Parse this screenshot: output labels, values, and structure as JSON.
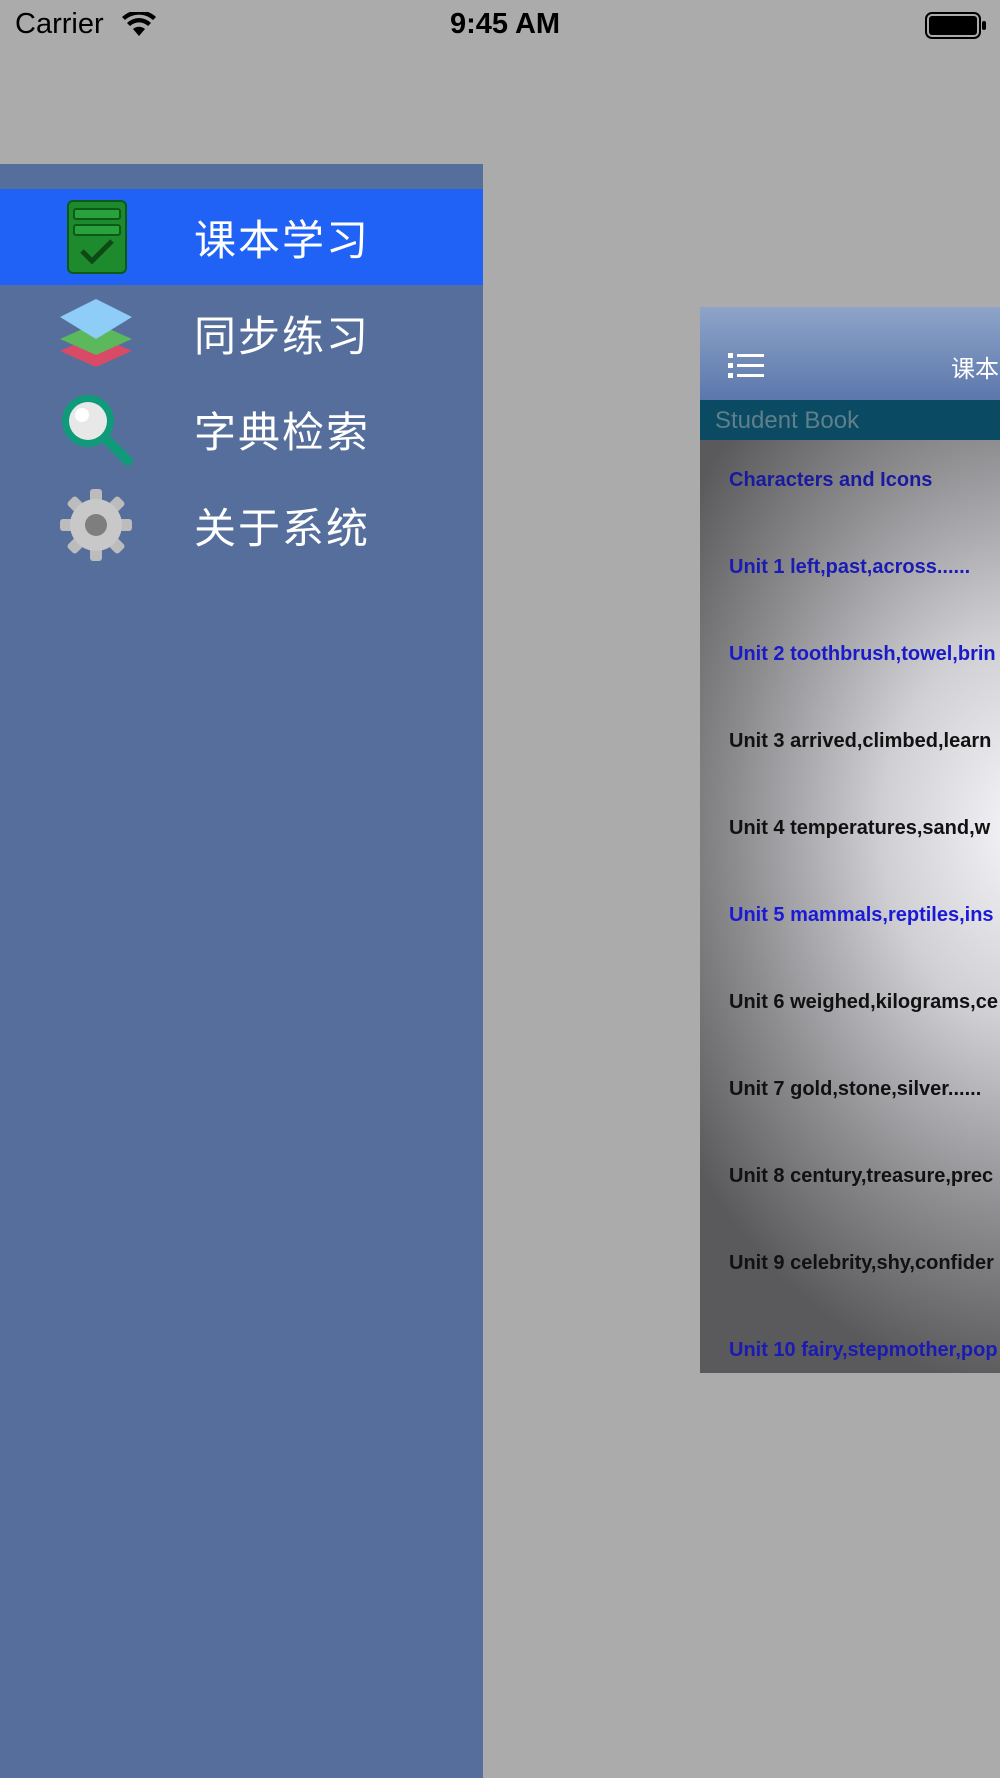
{
  "status_bar": {
    "carrier": "Carrier",
    "time": "9:45 AM"
  },
  "side_menu": {
    "items": [
      {
        "label": "课本学习",
        "icon": "textbook-checklist-icon",
        "active": true
      },
      {
        "label": "同步练习",
        "icon": "layers-icon",
        "active": false
      },
      {
        "label": "字典检索",
        "icon": "magnifier-icon",
        "active": false
      },
      {
        "label": "关于系统",
        "icon": "gear-icon",
        "active": false
      }
    ]
  },
  "preview": {
    "nav_title": "课本",
    "section_title": "Student Book",
    "rows": [
      {
        "text": "Characters and Icons",
        "color": "#1a1aa0"
      },
      {
        "text": "Unit 1 left,past,across......",
        "color": "#1a1ab4"
      },
      {
        "text": "Unit 2 toothbrush,towel,brin",
        "color": "#1a1ac8"
      },
      {
        "text": "Unit 3 arrived,climbed,learn",
        "color": "#111111"
      },
      {
        "text": "Unit 4 temperatures,sand,w",
        "color": "#111111"
      },
      {
        "text": "Unit 5 mammals,reptiles,ins",
        "color": "#1a1ad6"
      },
      {
        "text": "Unit 6 weighed,kilograms,ce",
        "color": "#111111"
      },
      {
        "text": "Unit 7 gold,stone,silver......",
        "color": "#111111"
      },
      {
        "text": "Unit 8 century,treasure,prec",
        "color": "#111111"
      },
      {
        "text": "Unit 9 celebrity,shy,confider",
        "color": "#111111"
      },
      {
        "text": "Unit 10 fairy,stepmother,pop",
        "color": "#1a1ab4"
      }
    ]
  },
  "colors": {
    "background": "#ababab",
    "menu_background": "#556e9c",
    "menu_active": "#1f62f5",
    "section_header": "#0b4a63"
  }
}
